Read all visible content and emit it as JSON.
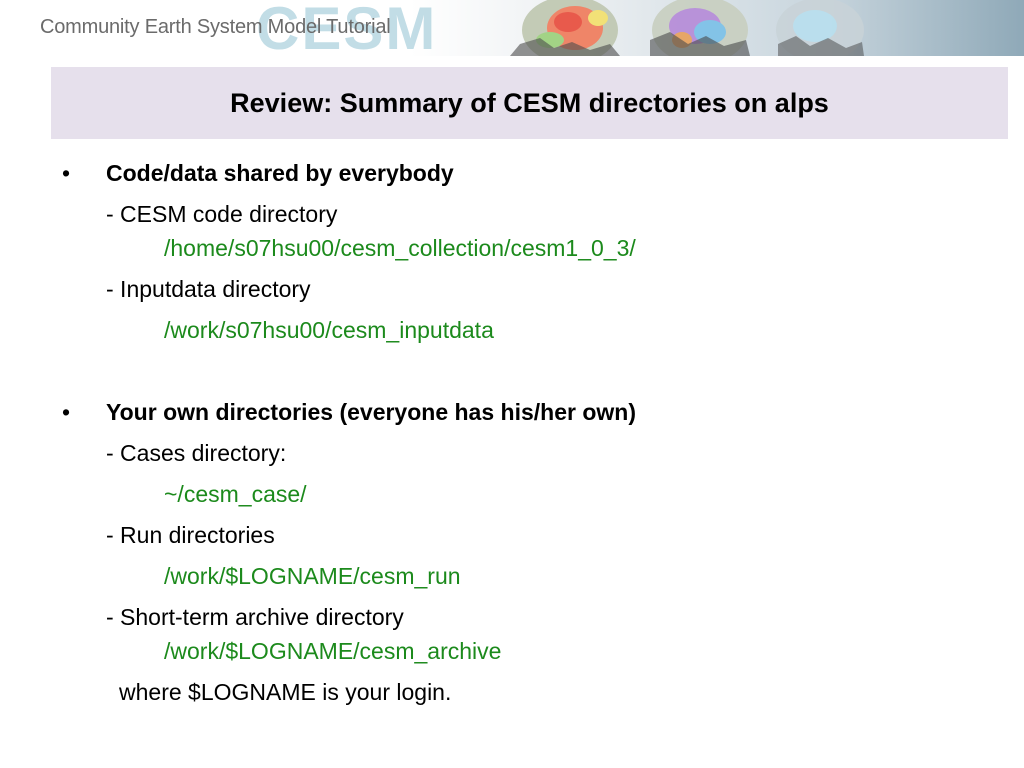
{
  "banner": {
    "title": "Community Earth System Model Tutorial",
    "logo": "CESM"
  },
  "slide": {
    "title": "Review: Summary of CESM directories on alps",
    "section1": {
      "bullet": "•",
      "heading": "Code/data shared by everybody",
      "code_label": "- CESM code directory",
      "code_path": "/home/s07hsu00/cesm_collection/cesm1_0_3/",
      "input_label": "- Inputdata directory",
      "input_path": "/work/s07hsu00/cesm_inputdata"
    },
    "section2": {
      "bullet": "•",
      "heading": "Your own directories (everyone has his/her own)",
      "cases_label": "- Cases directory:",
      "cases_path": "~/cesm_case/",
      "run_label": "- Run directories",
      "run_path": "/work/$LOGNAME/cesm_run",
      "archive_label": "- Short-term archive directory",
      "archive_path": "/work/$LOGNAME/cesm_archive",
      "note": "where $LOGNAME is your login."
    }
  },
  "colors": {
    "title_bg": "#e6e0ec",
    "path_green": "#1c8a1c"
  }
}
